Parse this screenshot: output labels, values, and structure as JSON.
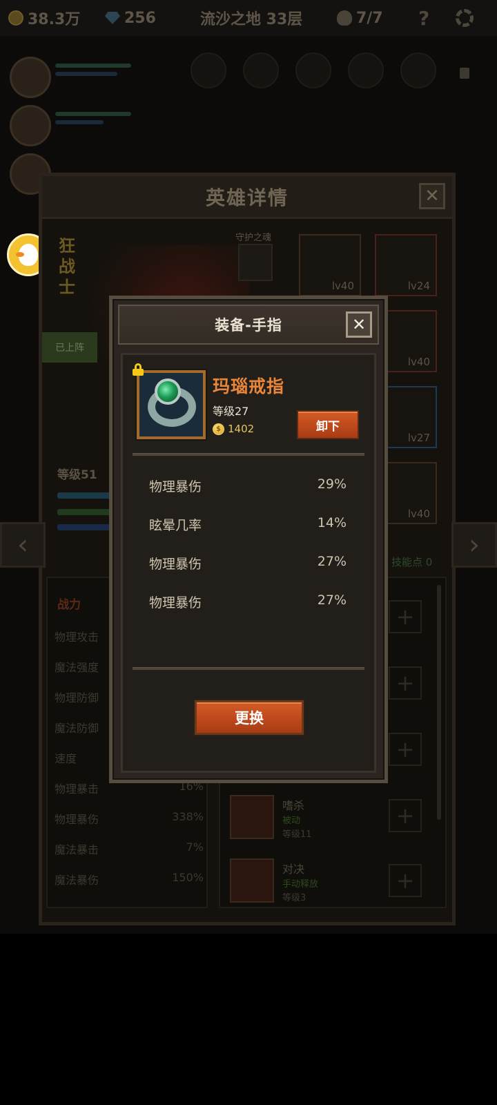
{
  "topbar": {
    "gold": "38.3万",
    "gems": "256",
    "stage": "流沙之地 33层",
    "lives": "7/7",
    "help": "?"
  },
  "hero_panel": {
    "title": "英雄详情",
    "close": "✕",
    "hero_name": "狂战士",
    "guard_label": "守护之魂",
    "deployed": "已上阵",
    "level": "等级51",
    "skill_points_label": "技能点 0",
    "equip_slots": [
      {
        "level": "lv40"
      },
      {
        "level": "lv24"
      },
      {
        "level": "lv40"
      },
      {
        "level": "lv27"
      },
      {
        "level": "lv40"
      }
    ],
    "stats_title": "战力",
    "stats": [
      {
        "name": "物理攻击",
        "value": ""
      },
      {
        "name": "魔法强度",
        "value": ""
      },
      {
        "name": "物理防御",
        "value": ""
      },
      {
        "name": "魔法防御",
        "value": ""
      },
      {
        "name": "速度",
        "value": ""
      },
      {
        "name": "物理暴击",
        "value": "16%"
      },
      {
        "name": "物理暴伤",
        "value": "338%"
      },
      {
        "name": "魔法暴击",
        "value": "7%"
      },
      {
        "name": "魔法暴伤",
        "value": "150%"
      }
    ],
    "skills": [
      {
        "name": "嗜杀",
        "type": "被动",
        "level": "等级11"
      },
      {
        "name": "对决",
        "type": "手动释放",
        "level": "等级3"
      }
    ],
    "plus": "+"
  },
  "modal": {
    "title": "装备-手指",
    "close": "✕",
    "item": {
      "name": "玛瑙戒指",
      "level": "等级27",
      "price": "1402",
      "unequip_label": "卸下"
    },
    "attributes": [
      {
        "name": "物理暴伤",
        "value": "29%"
      },
      {
        "name": "眩晕几率",
        "value": "14%"
      },
      {
        "name": "物理暴伤",
        "value": "27%"
      },
      {
        "name": "物理暴伤",
        "value": "27%"
      }
    ],
    "replace_label": "更换"
  },
  "colors": {
    "accent_orange": "#e9863a",
    "button_orange": "#c04a1e",
    "gold_text": "#e6c45c"
  }
}
